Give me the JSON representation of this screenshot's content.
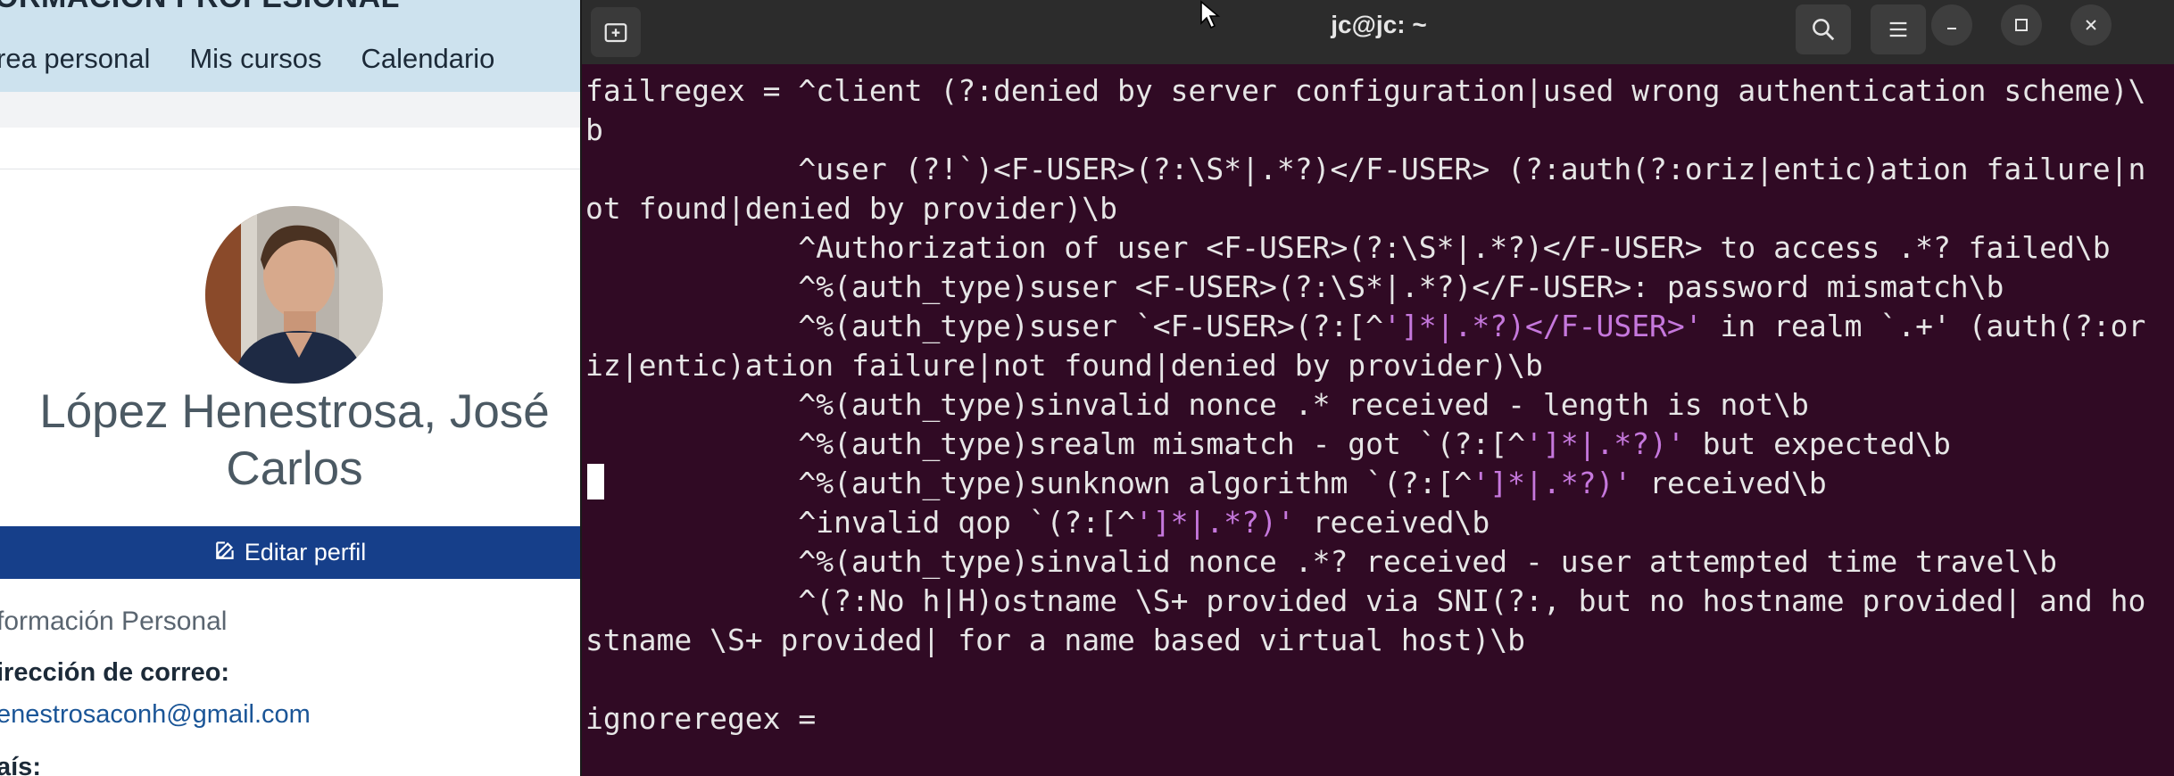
{
  "browser": {
    "site_title": "ORMACION PROFESIONAL",
    "nav": [
      "rea personal",
      "Mis cursos",
      "Calendario"
    ],
    "profile": {
      "name": "López Henestrosa, José Carlos",
      "edit_button": "Editar perfil",
      "section_title": "formación Personal",
      "email_label": "irección de correo:",
      "email_value": "enestrosaconh@gmail.com",
      "country_label": "aís:"
    }
  },
  "terminal": {
    "title": "jc@jc: ~",
    "lines": [
      [
        {
          "t": "failregex = ^client (?:denied by server configuration|used wrong authentication scheme)\\"
        }
      ],
      [
        {
          "t": "b"
        }
      ],
      [
        {
          "t": "            ^user (?!`)<F-USER>(?:\\S*|.*?)</F-USER> (?:auth(?:oriz|entic)ation failure|n"
        }
      ],
      [
        {
          "t": "ot found|denied by provider)\\b"
        }
      ],
      [
        {
          "t": "            ^Authorization of user <F-USER>(?:\\S*|.*?)</F-USER> to access .*? failed\\b"
        }
      ],
      [
        {
          "t": "            ^%(auth_type)suser <F-USER>(?:\\S*|.*?)</F-USER>: password mismatch\\b"
        }
      ],
      [
        {
          "t": "            ^%(auth_type)suser `<F-USER>(?:[^"
        },
        {
          "t": "']*|.*?)</F-USER>'",
          "c": "str"
        },
        {
          "t": " in realm `.+' (auth(?:or"
        }
      ],
      [
        {
          "t": "iz|entic)ation failure|not found|denied by provider)\\b"
        }
      ],
      [
        {
          "t": "            ^%(auth_type)sinvalid nonce .* received - length is not\\b"
        }
      ],
      [
        {
          "t": "            ^%(auth_type)srealm mismatch - got `(?:[^"
        },
        {
          "t": "']*|.*?)'",
          "c": "str"
        },
        {
          "t": " but expected\\b"
        }
      ],
      [
        {
          "t": "            ^%(auth_type)sunknown algorithm `(?:[^"
        },
        {
          "t": "']*|.*?)'",
          "c": "str"
        },
        {
          "t": " received\\b"
        }
      ],
      [
        {
          "t": "            ^invalid qop `(?:[^"
        },
        {
          "t": "']*|.*?)'",
          "c": "str"
        },
        {
          "t": " received\\b"
        }
      ],
      [
        {
          "t": "            ^%(auth_type)sinvalid nonce .*? received - user attempted time travel\\b"
        }
      ],
      [
        {
          "t": "            ^(?:No h|H)ostname \\S+ provided via SNI(?:, but no hostname provided| and ho"
        }
      ],
      [
        {
          "t": "stname \\S+ provided| for a name based virtual host)\\b"
        }
      ],
      [
        {
          "t": ""
        }
      ],
      [
        {
          "t": "ignoreregex ="
        }
      ]
    ]
  },
  "icons": {
    "new_tab": "new-tab-icon",
    "search": "search-icon",
    "menu": "hamburger-menu-icon",
    "minimize": "minimize-icon",
    "maximize": "maximize-icon",
    "close": "close-icon",
    "edit": "pencil-edit-icon"
  },
  "colors": {
    "terminal_bg": "#300a24",
    "terminal_fg": "#e6e6e6",
    "string_highlight": "#c678dd",
    "moodle_header": "#cde2ee",
    "edit_button_bg": "#163f8a",
    "link": "#1a5597"
  }
}
